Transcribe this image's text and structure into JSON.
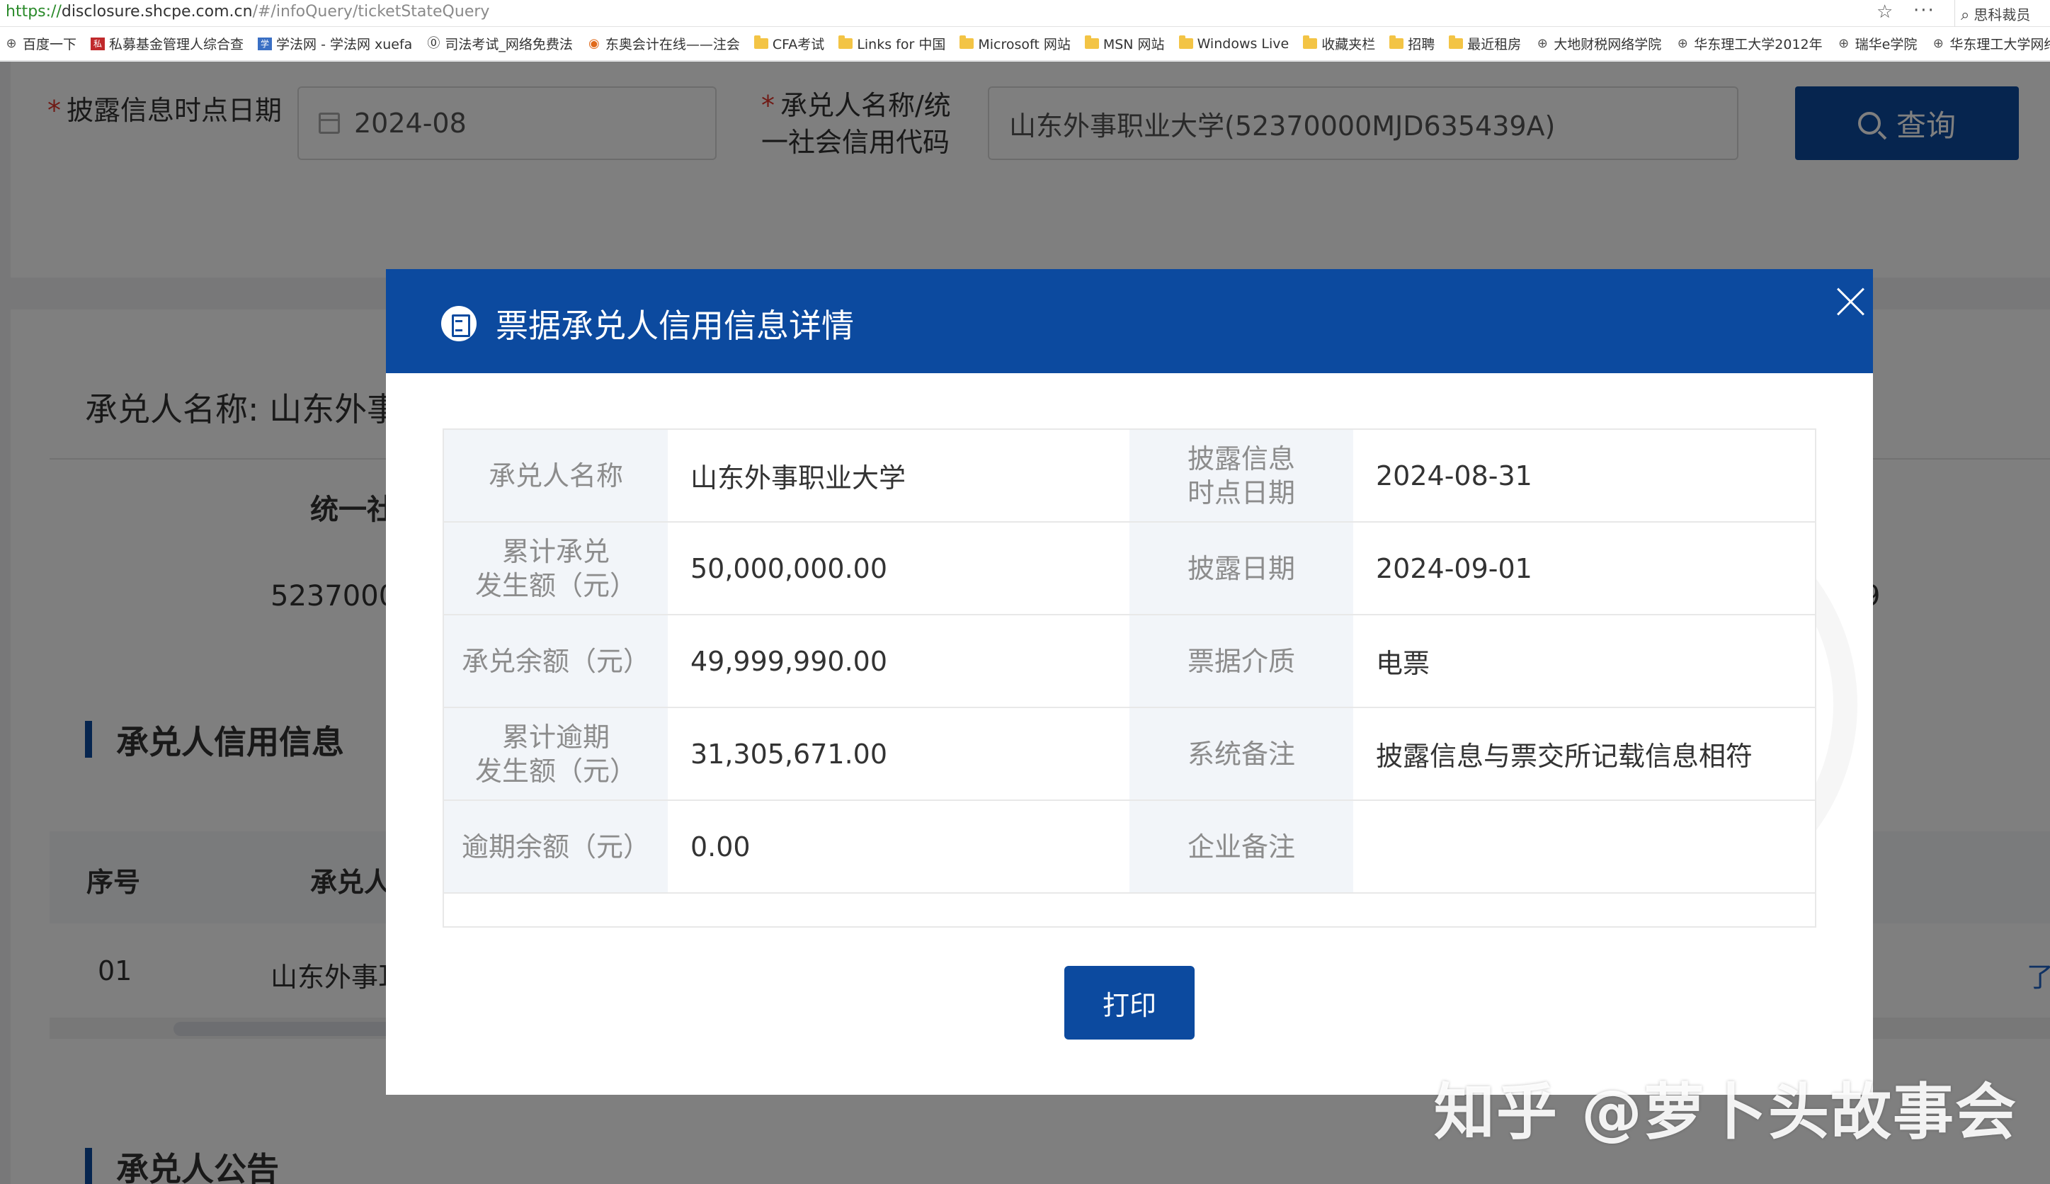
{
  "browser": {
    "url_protocol": "https://",
    "url_host": "disclosure.shcpe.com.cn",
    "url_path": "/#/infoQuery/ticketStateQuery",
    "search_label": "思科裁员",
    "bookmarks": [
      {
        "label": "百度一下",
        "icon": "globe-icon"
      },
      {
        "label": "私募基金管理人综合查",
        "icon": "red-square-icon"
      },
      {
        "label": "学法网 - 学法网 xuefa",
        "icon": "blue-square-icon"
      },
      {
        "label": "司法考试_网络免费法",
        "icon": "circle-logo-icon"
      },
      {
        "label": "东奥会计在线——注会",
        "icon": "orange-logo-icon"
      },
      {
        "label": "CFA考试",
        "icon": "folder-icon"
      },
      {
        "label": "Links for 中国",
        "icon": "folder-icon"
      },
      {
        "label": "Microsoft 网站",
        "icon": "folder-icon"
      },
      {
        "label": "MSN 网站",
        "icon": "folder-icon"
      },
      {
        "label": "Windows Live",
        "icon": "folder-icon"
      },
      {
        "label": "收藏夹栏",
        "icon": "folder-icon"
      },
      {
        "label": "招聘",
        "icon": "folder-icon"
      },
      {
        "label": "最近租房",
        "icon": "folder-icon"
      },
      {
        "label": "大地财税网络学院",
        "icon": "globe-icon"
      },
      {
        "label": "华东理工大学2012年",
        "icon": "globe-icon"
      },
      {
        "label": "瑞华e学院",
        "icon": "globe-icon"
      },
      {
        "label": "华东理工大学网络教育",
        "icon": "globe-icon"
      }
    ]
  },
  "search_form": {
    "date_label": "披露信息时点日期",
    "date_value": "2024-08",
    "acceptor_label_line1": "承兑人名称/统",
    "acceptor_label_line2": "一社会信用代码",
    "acceptor_value": "山东外事职业大学(52370000MJD635439A)",
    "query_button": "查询"
  },
  "background": {
    "acceptor_name_prefix": "承兑人名称: 山东外事",
    "credit_code_header": "统一社",
    "credit_code_partial": "52370000",
    "right_partial": "9",
    "credit_section_title": "承兑人信用信息",
    "col_index": "序号",
    "col_acceptor": "承兑人",
    "row_index": "01",
    "row_acceptor_partial": "山东外事耳",
    "right_edge_text": "了",
    "notice_section_title": "承兑人公告"
  },
  "modal": {
    "title": "票据承兑人信用信息详情",
    "rows": [
      {
        "label_l": "承兑人名称",
        "value_l": "山东外事职业大学",
        "label_r": "披露信息\n时点日期",
        "value_r": "2024-08-31"
      },
      {
        "label_l": "累计承兑\n发生额（元）",
        "value_l": "50,000,000.00",
        "label_r": "披露日期",
        "value_r": "2024-09-01"
      },
      {
        "label_l": "承兑余额（元）",
        "value_l": "49,999,990.00",
        "label_r": "票据介质",
        "value_r": "电票"
      },
      {
        "label_l": "累计逾期\n发生额（元）",
        "value_l": "31,305,671.00",
        "label_r": "系统备注",
        "value_r": "披露信息与票交所记载信息相符"
      },
      {
        "label_l": "逾期余额（元）",
        "value_l": "0.00",
        "label_r": "企业备注",
        "value_r": ""
      }
    ],
    "print_button": "打印"
  },
  "watermark": "知乎 @萝卜头故事会"
}
